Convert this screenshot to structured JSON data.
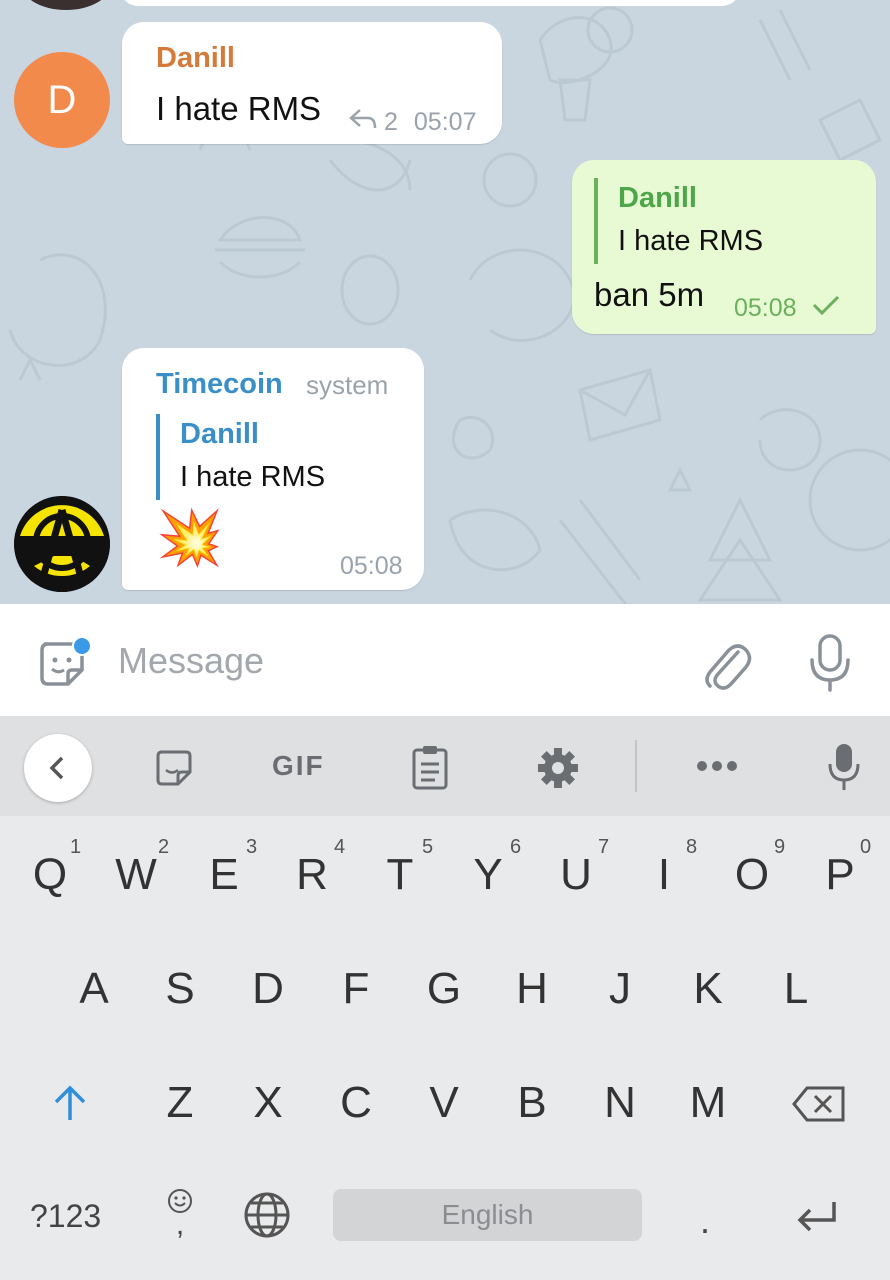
{
  "messages": {
    "m1": {
      "sender": "Danill",
      "text": "I hate RMS",
      "reply_count": "2",
      "time": "05:07",
      "avatar_letter": "D"
    },
    "m2": {
      "quote_name": "Danill",
      "quote_text": "I hate RMS",
      "text": "ban 5m",
      "time": "05:08"
    },
    "m3": {
      "sender": "Timecoin",
      "badge": "system",
      "quote_name": "Danill",
      "quote_text": "I hate RMS",
      "emoji": "💥",
      "time": "05:08"
    }
  },
  "input": {
    "placeholder": "Message"
  },
  "keyboard": {
    "toolbar": {
      "gif": "GIF"
    },
    "row1": [
      "Q",
      "W",
      "E",
      "R",
      "T",
      "Y",
      "U",
      "I",
      "O",
      "P"
    ],
    "row1_nums": [
      "1",
      "2",
      "3",
      "4",
      "5",
      "6",
      "7",
      "8",
      "9",
      "0"
    ],
    "row2": [
      "A",
      "S",
      "D",
      "F",
      "G",
      "H",
      "J",
      "K",
      "L"
    ],
    "row3": [
      "Z",
      "X",
      "C",
      "V",
      "B",
      "N",
      "M"
    ],
    "symbols_key": "?123",
    "space_label": "English",
    "period": ".",
    "comma": ","
  },
  "colors": {
    "accent_orange": "#d67a3a",
    "accent_blue": "#3a8fc9",
    "accent_green": "#4ea64a",
    "shift_blue": "#2f8fd8"
  },
  "icons": {
    "sticker": "sticker-icon",
    "attach": "paperclip-icon",
    "mic": "microphone-icon",
    "back": "chevron-left-icon",
    "clipboard": "clipboard-icon",
    "settings": "gear-icon",
    "more": "more-dots-icon",
    "shift": "shift-arrow-icon",
    "backspace": "backspace-icon",
    "globe": "globe-icon",
    "enter": "enter-icon",
    "emoji": "smiley-icon",
    "check": "check-icon",
    "reply": "reply-arrow-icon"
  }
}
